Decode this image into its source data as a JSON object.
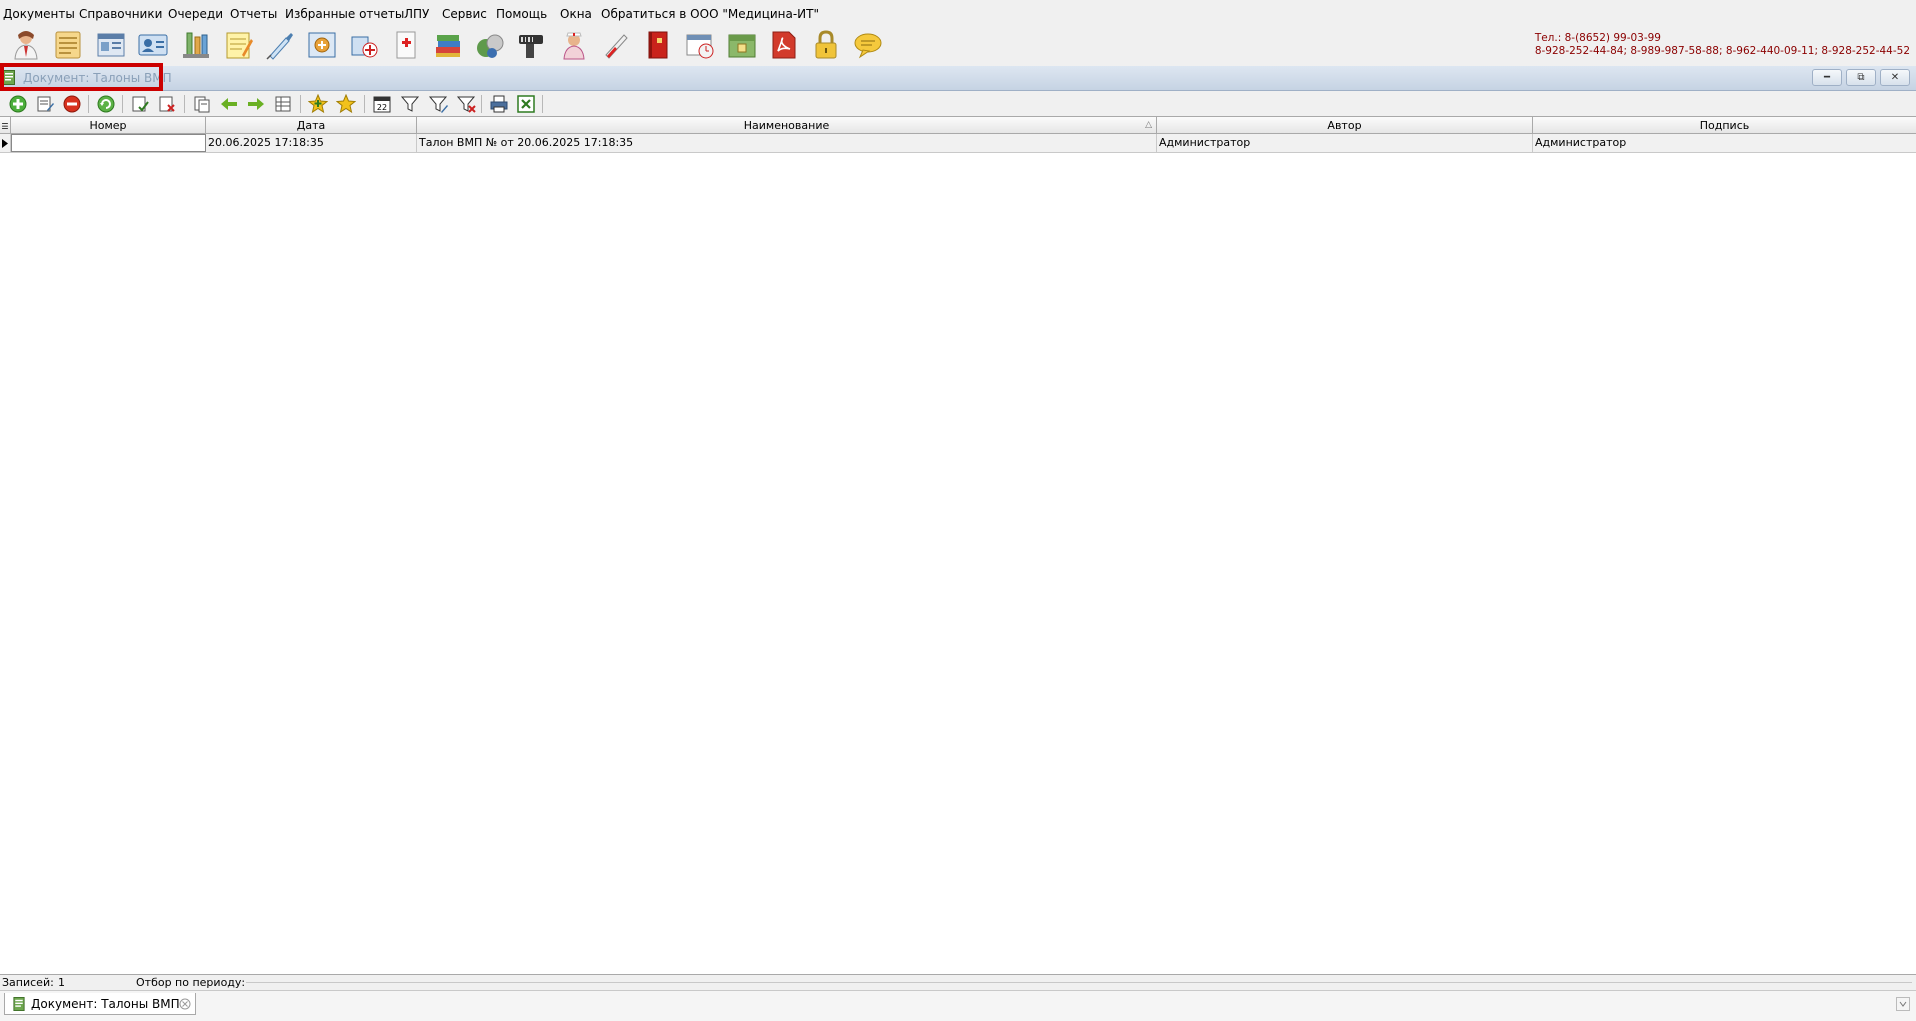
{
  "menu": {
    "items": [
      "Документы",
      "Справочники",
      "Очереди",
      "Отчеты",
      "Избранные отчеты",
      "ЛПУ",
      "Сервис",
      "Помощь",
      "Окна",
      "Обратиться в ООО \"Медицина-ИТ\""
    ]
  },
  "contacts": {
    "line1": "Тел.: 8-(8652) 99-03-99",
    "line2": "8-928-252-44-84; 8-989-987-58-88; 8-962-440-09-11; 8-928-252-44-52"
  },
  "toolbar_icons": [
    "doctor-icon",
    "journal-icon",
    "cards-icon",
    "id-card-icon",
    "lab-flask-icon",
    "notepad-icon",
    "syringe-icon",
    "registry-icon",
    "pharmacy-icon",
    "medical-record-icon",
    "books-icon",
    "pills-icon",
    "barcode-scanner-icon",
    "nurse-icon",
    "thermometer-icon",
    "red-book-icon",
    "calendar-icon",
    "archive-icon",
    "pdf-icon",
    "lock-icon",
    "chat-icon"
  ],
  "document_window": {
    "title": "Документ: Талоны ВМП",
    "highlight_color": "#cc0000"
  },
  "doc_toolbar_icons": [
    "add-icon",
    "edit-icon",
    "delete-icon",
    "refresh-icon",
    "check-icon",
    "uncheck-icon",
    "copy-icon",
    "arrow-left-icon",
    "arrow-right-icon",
    "columns-icon",
    "star-add-icon",
    "star-icon",
    "calendar-filter-icon",
    "filter-icon",
    "filter-edit-icon",
    "filter-clear-icon",
    "print-icon",
    "excel-icon"
  ],
  "grid": {
    "columns": [
      "Номер",
      "Дата",
      "Наименование",
      "Автор",
      "Подпись"
    ],
    "sorted_column_marker": "△",
    "rows": [
      {
        "number": "",
        "date": "20.06.2025 17:18:35",
        "name": "Талон ВМП № от 20.06.2025 17:18:35",
        "author": "Администратор",
        "signature": "Администратор"
      }
    ]
  },
  "status": {
    "records_label": "Записей:",
    "records_count": "1",
    "period_filter_label": "Отбор по периоду:"
  },
  "tab": {
    "label": "Документ: Талоны ВМП"
  }
}
